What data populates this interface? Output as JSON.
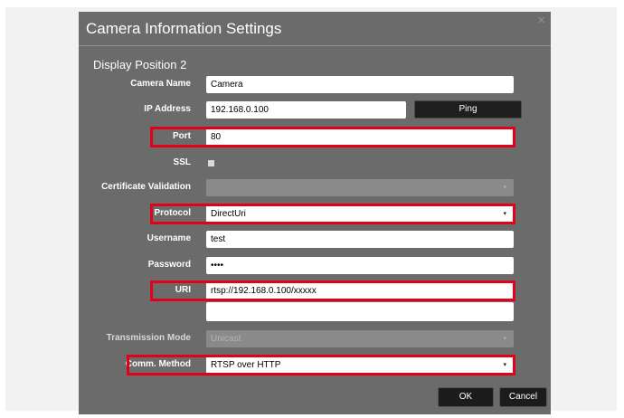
{
  "dialog": {
    "title": "Camera Information Settings",
    "close_label": "×",
    "section": "Display Position 2"
  },
  "form": {
    "camera_name": {
      "label": "Camera Name",
      "value": "Camera"
    },
    "ip_address": {
      "label": "IP Address",
      "value": "192.168.0.100"
    },
    "ping_label": "Ping",
    "port": {
      "label": "Port",
      "value": "80"
    },
    "ssl": {
      "label": "SSL",
      "checked": false
    },
    "certificate_validation": {
      "label": "Certificate Validation",
      "value": "",
      "disabled": true
    },
    "protocol": {
      "label": "Protocol",
      "value": "DirectUri"
    },
    "username": {
      "label": "Username",
      "value": "test"
    },
    "password": {
      "label": "Password",
      "value": "••••"
    },
    "uri": {
      "label": "URI",
      "value": "rtsp://192.168.0.100/xxxxx",
      "extra_value": ""
    },
    "transmission_mode": {
      "label": "Transmission Mode",
      "value": "Unicast",
      "disabled": true
    },
    "comm_method": {
      "label": "Comm. Method",
      "value": "RTSP over HTTP"
    }
  },
  "footer": {
    "ok_label": "OK",
    "cancel_label": "Cancel"
  },
  "icons": {
    "dropdown_caret": "▾"
  },
  "colors": {
    "dialog_background": "#6b6b6b",
    "highlight": "#e2001a",
    "button": "#1c1c1c"
  }
}
